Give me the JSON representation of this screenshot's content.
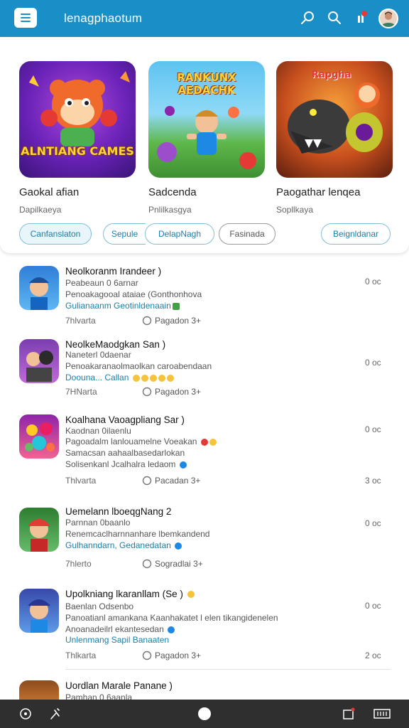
{
  "app_bar": {
    "title": "lenagphaotum",
    "icons": [
      "menu-icon",
      "search-icon",
      "search-icon",
      "notification-icon",
      "avatar"
    ],
    "color": "#1a8fc7"
  },
  "featured": {
    "items": [
      {
        "banner_text": "ALNTIANG CAMES",
        "title": "Gaokal afian",
        "subtitle": "Dapilkaeya"
      },
      {
        "banner_text": "RANKUNX AEDACHK",
        "title": "Sadcenda",
        "subtitle": "Pnlilkasgya"
      },
      {
        "banner_text": "Rapgha",
        "title": "Paogathar lenqea",
        "subtitle": "Sopllkaya"
      }
    ],
    "chips": [
      {
        "label": "Canfanslaton",
        "selected": true
      },
      {
        "label": "Sepule",
        "selected": false
      },
      {
        "label": "DelapNagh",
        "selected": false
      },
      {
        "label": "Fasinada",
        "selected": false
      },
      {
        "label": "Beignldanar",
        "selected": false
      }
    ]
  },
  "list": [
    {
      "title": "Neolkoranm Irandeer )",
      "line1": "Peabeaun 0 6arnar",
      "line2": "Penoakagooal ataiae (Gonthonhova",
      "line3": "Gulianaanm Geotinldenaain",
      "meta_left": "7hlvarta",
      "meta_mid": "Pagadon 3+",
      "right_top": "0 oc",
      "right_bottom": ""
    },
    {
      "title": "NeolkeMaodgkan San )",
      "line1": "Naneterl 0daenar",
      "line2": "Penoakaranaolmaolkan caroabendaan",
      "line3": "Doouna... Callan",
      "meta_left": "7HNarta",
      "meta_mid": "Pagadon 3+",
      "right_top": "0 oc",
      "right_bottom": ""
    },
    {
      "title": "Koalhana Vaoagpliang Sar )",
      "line1": "Kaodnan 0ilaenlu",
      "line2": "Pagoadalm lanlouamelne Voeakan",
      "line3": "Samacsan aahaalbasedarlokan",
      "line4": "Solisenkanl Jcalhalra ledaom",
      "meta_left": "Thlvarta",
      "meta_mid": "Pacadan 3+",
      "right_top": "0 oc",
      "right_bottom": "3 oc"
    },
    {
      "title": "Uemelann lboeqgNang 2",
      "line1": "Parnnan 0baanlo",
      "line2": "Renemcaclharnnanhare lbemkandend",
      "line3": "Gulhanndarn, Gedanedatan",
      "meta_left": "7hlerto",
      "meta_mid": "Sogradlai 3+",
      "right_top": "0 oc",
      "right_bottom": ""
    },
    {
      "title": "Upolkniang lkaranllam (Se )",
      "line1": "Baenlan Odsenbo",
      "line2": "Panoatianl amankana Kaanhakatet l elen tikangidenelen",
      "line3": "Anoanadeilrl ekantesedan",
      "line4": "Unlenmang Sapil Banaaten",
      "meta_left": "Thlkarta",
      "meta_mid": "Pagadon 3+",
      "right_top": "0 oc",
      "right_bottom": "2 oc"
    },
    {
      "title": "Uordlan Marale Panane )",
      "line1": "Pamhan 0 6aanla",
      "meta_left": "",
      "meta_mid": "",
      "right_top": "",
      "right_bottom": ""
    }
  ],
  "nav": {
    "icons": [
      "back-icon",
      "tools-icon",
      "home-icon",
      "recents-icon",
      "keyboard-icon"
    ]
  }
}
